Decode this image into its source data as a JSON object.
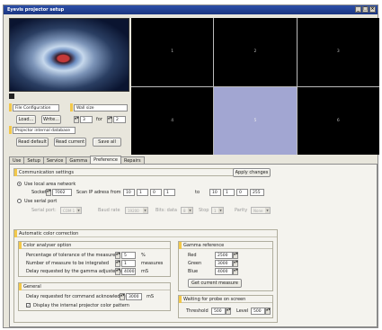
{
  "window": {
    "title": "Eyevis projector setup"
  },
  "grid": {
    "cells": [
      "1",
      "2",
      "3",
      "4",
      "5",
      "6"
    ],
    "selected_index": 4
  },
  "top_left": {
    "file_config_label": "File Configuration",
    "wall_size_label": "Wall size",
    "load_label": "Load...",
    "write_label": "Write...",
    "wall_cols": "3",
    "for_label": "for",
    "wall_rows": "2",
    "internal_db_label": "Projector internal database",
    "read_default_label": "Read default",
    "read_current_label": "Read current",
    "save_all_label": "Save all"
  },
  "tabs": [
    {
      "label": "Use",
      "active": false
    },
    {
      "label": "Setup",
      "active": false
    },
    {
      "label": "Service",
      "active": false
    },
    {
      "label": "Gamma",
      "active": false
    },
    {
      "label": "Preference",
      "active": true
    },
    {
      "label": "Repairs",
      "active": false
    }
  ],
  "comm": {
    "header": "Communication settings",
    "apply_label": "Apply changes",
    "use_lan_label": "Use local area network",
    "socket_label": "Socket",
    "socket_value": "7002",
    "scan_label": "Scan IP adress from",
    "ip_from": [
      "10",
      "1",
      "0",
      "1"
    ],
    "to_label": "to",
    "ip_to": [
      "10",
      "1",
      "0",
      "255"
    ],
    "use_serial_label": "Use serial port",
    "serial_port_label": "Serial port:",
    "serial_port_value": "COM 1",
    "baud_label": "Baud rate",
    "baud_value": "19200",
    "bits_label": "Bits: data",
    "bits_value": "8",
    "stop_label": "Stop",
    "stop_value": "1",
    "parity_label": "Parity",
    "parity_value": "None"
  },
  "auto": {
    "header": "Automatic color correction",
    "analyzer": {
      "header": "Color analyser option",
      "tolerance_label": "Percentage of tolerance of the measures",
      "tolerance_value": "5",
      "tolerance_unit": "%",
      "count_label": "Number of measure to be integrated",
      "count_value": "1",
      "count_unit": "measures",
      "delay_label": "Delay requested by the gamma adjustement",
      "delay_value": "4000",
      "delay_unit": "mS"
    },
    "gamma": {
      "header": "Gamma reference",
      "red_label": "Red",
      "red_value": "2500",
      "green_label": "Green",
      "green_value": "3000",
      "blue_label": "Blue",
      "blue_value": "4000",
      "get_label": "Get current measure"
    },
    "general": {
      "header": "General",
      "ack_label": "Delay requested for command acknowledgement",
      "ack_value": "3000",
      "ack_unit": "mS",
      "display_label": "Display the internal projector color pattern"
    },
    "probe": {
      "header": "Waiting for probe on screen",
      "threshold_label": "Threshold",
      "threshold_value": "500",
      "level_label": "Level",
      "level_value": "500"
    }
  },
  "colors": {
    "accent": "#f2c84a",
    "title": "#1b3580",
    "selected_cell": "#a2a6d2"
  }
}
